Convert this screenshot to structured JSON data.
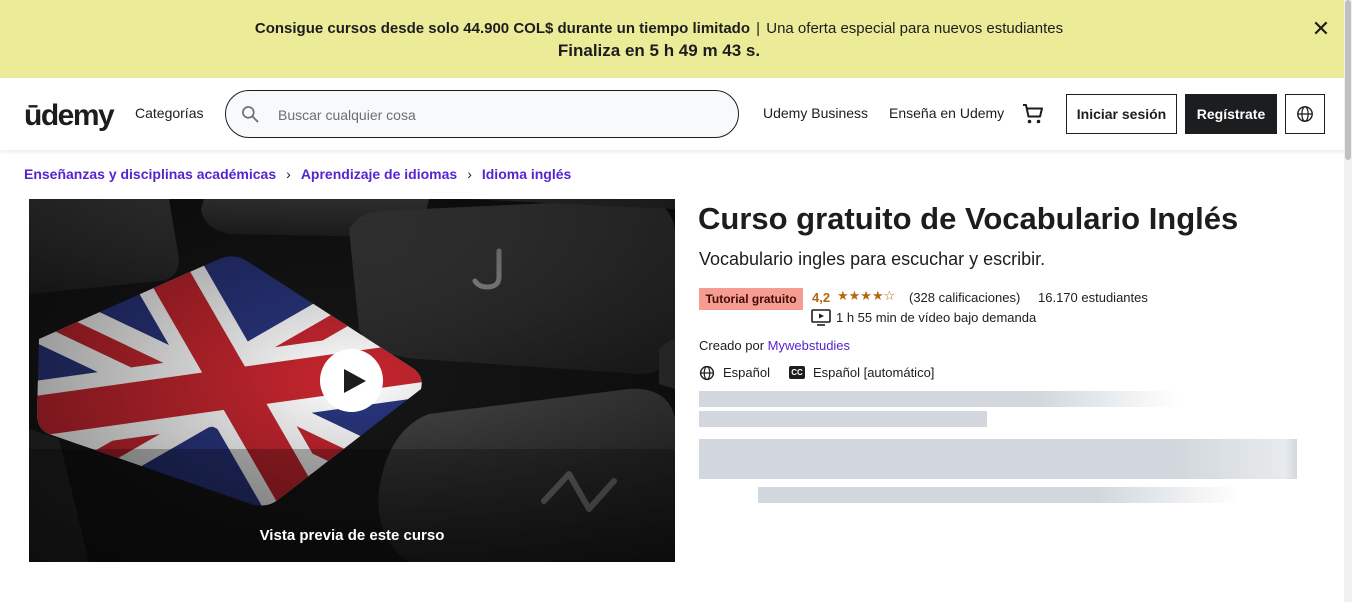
{
  "banner": {
    "strong": "Consigue cursos desde solo 44.900 COL$ durante un tiempo limitado",
    "separator": "|",
    "rest": "Una oferta especial para nuevos estudiantes",
    "countdown": "Finaliza en 5 h 49 m 43 s.",
    "close_symbol": "✕"
  },
  "header": {
    "logo": "ūdemy",
    "categories": "Categorías",
    "search_placeholder": "Buscar cualquier cosa",
    "business": "Udemy Business",
    "teach": "Enseña en Udemy",
    "login": "Iniciar sesión",
    "signup": "Regístrate"
  },
  "breadcrumb": {
    "items": [
      "Enseñanzas y disciplinas académicas",
      "Aprendizaje de idiomas",
      "Idioma inglés"
    ],
    "separator": "›"
  },
  "preview": {
    "label": "Vista previa de este curso"
  },
  "course": {
    "title": "Curso gratuito de Vocabulario Inglés",
    "subtitle": "Vocabulario ingles para escuchar y escribir.",
    "badge": "Tutorial gratuito",
    "rating": "4,2",
    "stars": "★★★★☆",
    "rating_value": 4.2,
    "ratings_count": "(328 calificaciones)",
    "students": "16.170 estudiantes",
    "duration": "1 h 55 min de vídeo bajo demanda",
    "created_by_label": "Creado por",
    "author": "Mywebstudies",
    "language": "Español",
    "captions": "Español [automático]",
    "cc_label": "CC"
  },
  "colors": {
    "banner_bg": "#eceb98",
    "link_purple": "#5624d0",
    "star_orange": "#b4690e",
    "badge_bg": "#f69c92",
    "text_dark": "#1c1d1f"
  },
  "icons": [
    "close-icon",
    "search-icon",
    "cart-icon",
    "globe-icon",
    "chevron-right-icon",
    "play-icon",
    "video-icon",
    "closed-captions-icon"
  ]
}
